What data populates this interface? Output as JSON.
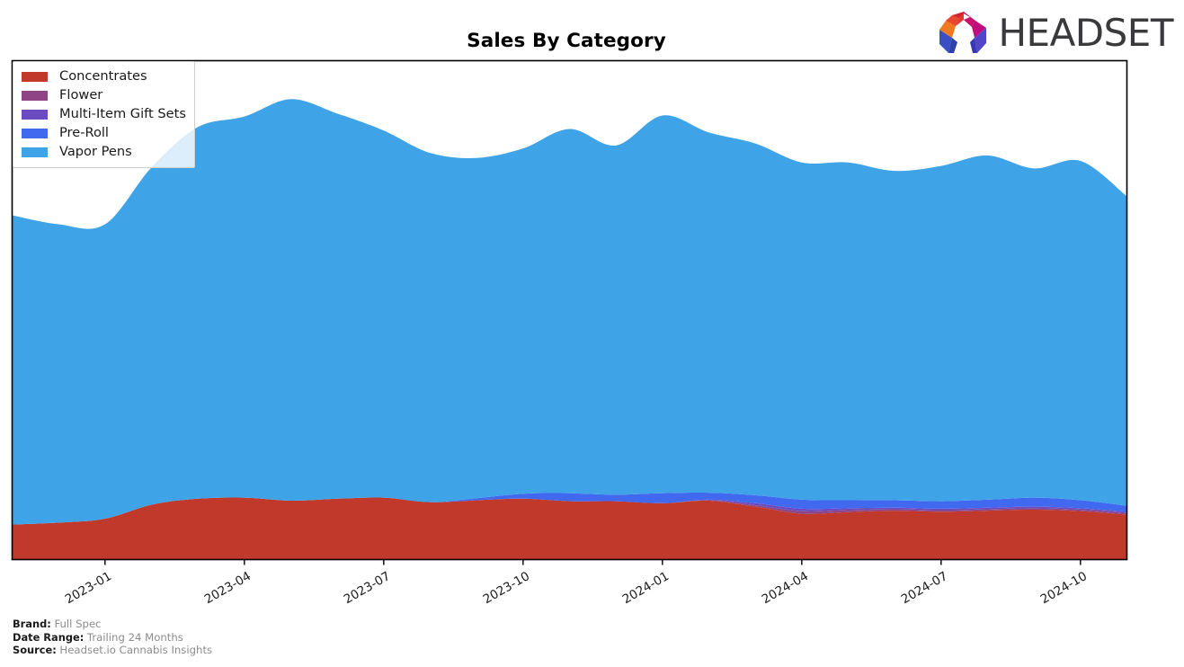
{
  "header": {
    "title": "Sales By Category",
    "logo_text": "HEADSET",
    "logo_icon": "headset-arch-logo"
  },
  "footer": {
    "lines": [
      {
        "key": "Brand:",
        "value": "Full Spec"
      },
      {
        "key": "Date Range:",
        "value": "Trailing 24 Months"
      },
      {
        "key": "Source:",
        "value": "Headset.io Cannabis Insights"
      }
    ]
  },
  "colors": {
    "concentrates": "#C0392B",
    "flower": "#8E4585",
    "multi_item_gift_sets": "#6A4CC0",
    "pre_roll": "#4169F0",
    "vapor_pens": "#3FA3E8",
    "axis": "#000000",
    "background": "#FFFFFF",
    "footer_value": "#8C8C8C"
  },
  "chart_data": {
    "type": "area",
    "stacked": true,
    "title": "Sales By Category",
    "xlabel": "",
    "ylabel": "",
    "grid": false,
    "legend_position": "upper left",
    "axis_ticks_rotation": -30,
    "xlim": [
      "2022-11",
      "2024-11"
    ],
    "ylim": [
      0,
      1.0
    ],
    "y_axis_labels_visible": false,
    "x": [
      "2022-11",
      "2022-12",
      "2023-01",
      "2023-02",
      "2023-03",
      "2023-04",
      "2023-05",
      "2023-06",
      "2023-07",
      "2023-08",
      "2023-09",
      "2023-10",
      "2023-11",
      "2023-12",
      "2024-01",
      "2024-02",
      "2024-03",
      "2024-04",
      "2024-05",
      "2024-06",
      "2024-07",
      "2024-08",
      "2024-09",
      "2024-10",
      "2024-11"
    ],
    "tick_labels": [
      "2023-01",
      "2023-04",
      "2023-07",
      "2023-10",
      "2024-01",
      "2024-04",
      "2024-07",
      "2024-10"
    ],
    "series": [
      {
        "name": "Concentrates",
        "color": "#C0392B",
        "values": [
          0.07,
          0.074,
          0.082,
          0.11,
          0.122,
          0.124,
          0.118,
          0.122,
          0.124,
          0.115,
          0.119,
          0.122,
          0.117,
          0.117,
          0.113,
          0.118,
          0.106,
          0.092,
          0.095,
          0.098,
          0.096,
          0.098,
          0.1,
          0.097,
          0.09
        ]
      },
      {
        "name": "Flower",
        "color": "#8E4585",
        "values": [
          0.0,
          0.0,
          0.0,
          0.0,
          0.0,
          0.0,
          0.0,
          0.0,
          0.0,
          0.0,
          0.0,
          0.0,
          0.0,
          0.0,
          0.0,
          0.001,
          0.003,
          0.005,
          0.004,
          0.003,
          0.003,
          0.003,
          0.003,
          0.003,
          0.003
        ]
      },
      {
        "name": "Multi-Item Gift Sets",
        "color": "#6A4CC0",
        "values": [
          0.0,
          0.0,
          0.0,
          0.0,
          0.0,
          0.0,
          0.0,
          0.0,
          0.0,
          0.0,
          0.0,
          0.0,
          0.0,
          0.0,
          0.0,
          0.001,
          0.004,
          0.005,
          0.004,
          0.003,
          0.003,
          0.003,
          0.003,
          0.003,
          0.003
        ]
      },
      {
        "name": "Pre-Roll",
        "color": "#4169F0",
        "values": [
          0.0,
          0.0,
          0.0,
          0.0,
          0.0,
          0.0,
          0.0,
          0.0,
          0.0,
          0.0,
          0.004,
          0.01,
          0.016,
          0.013,
          0.02,
          0.014,
          0.016,
          0.018,
          0.016,
          0.015,
          0.015,
          0.016,
          0.018,
          0.016,
          0.012
        ]
      },
      {
        "name": "Vapor Pens",
        "color": "#3FA3E8",
        "values": [
          0.62,
          0.598,
          0.59,
          0.676,
          0.745,
          0.764,
          0.805,
          0.772,
          0.736,
          0.7,
          0.682,
          0.692,
          0.73,
          0.7,
          0.757,
          0.722,
          0.705,
          0.676,
          0.677,
          0.66,
          0.672,
          0.69,
          0.66,
          0.68,
          0.62
        ]
      }
    ]
  },
  "legend": {
    "items": [
      {
        "label": "Concentrates",
        "color": "#C0392B"
      },
      {
        "label": "Flower",
        "color": "#8E4585"
      },
      {
        "label": "Multi-Item Gift Sets",
        "color": "#6A4CC0"
      },
      {
        "label": "Pre-Roll",
        "color": "#4169F0"
      },
      {
        "label": "Vapor Pens",
        "color": "#3FA3E8"
      }
    ]
  }
}
